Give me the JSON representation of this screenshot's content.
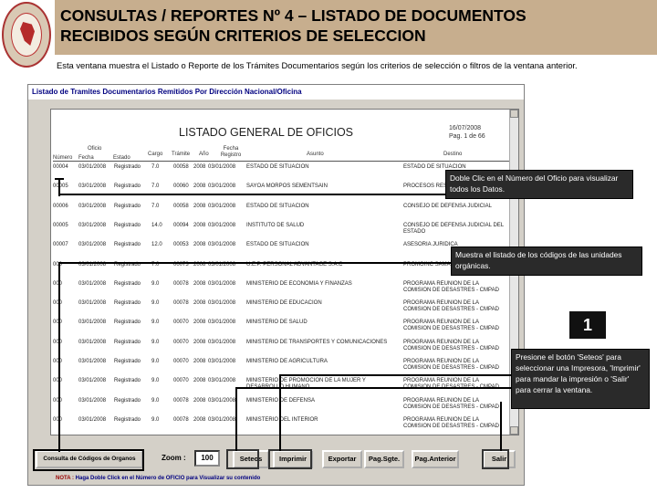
{
  "slide": {
    "title_line1": "CONSULTAS / REPORTES Nº 4 – LISTADO DE DOCUMENTOS",
    "title_line2": "RECIBIDOS SEGÚN CRITERIOS DE SELECCION",
    "intro": "Esta ventana muestra el Listado o Reporte de los Trámites Documentarios según los criterios de selección o filtros de la ventana anterior."
  },
  "window": {
    "title": "Listado de Tramites Documentarios Remitidos Por Dirección Nacional/Oficina",
    "report_title": "LISTADO GENERAL DE OFICIOS",
    "report_date": "16/07/2008",
    "report_page": "Pag. 1 de 66",
    "columns": {
      "numero": "Número",
      "oficio": "Oficio",
      "fecha": "Fecha",
      "estado": "Estado",
      "cargo": "Cargo",
      "tramite": "Trámite",
      "anio": "Año",
      "fecha_registro": "Fecha Registro",
      "asunto": "Asunto",
      "destino": "Destino"
    },
    "rows": [
      {
        "num": "00004",
        "date": "03/01/2008",
        "status": "Registrado",
        "cargo": "7.0",
        "tramite": "00058",
        "year": "2008",
        "freg": "03/01/2008",
        "asunto": "ESTADO DE SITUACION",
        "destino": "ESTADO DE SITUACION"
      },
      {
        "num": "00005",
        "date": "03/01/2008",
        "status": "Registrado",
        "cargo": "7.0",
        "tramite": "00060",
        "year": "2008",
        "freg": "03/01/2008",
        "asunto": "SAYOA MORPOS SEMENTSAIN",
        "destino": "PROCESOS RESOLUTIVOS"
      },
      {
        "num": "00006",
        "date": "03/01/2008",
        "status": "Registrado",
        "cargo": "7.0",
        "tramite": "00058",
        "year": "2008",
        "freg": "03/01/2008",
        "asunto": "ESTADO DE SITUACION",
        "destino": "CONSEJO DE DEFENSA JUDICIAL"
      },
      {
        "num": "00005",
        "date": "03/01/2008",
        "status": "Registrado",
        "cargo": "14.0",
        "tramite": "00094",
        "year": "2008",
        "freg": "03/01/2008",
        "asunto": "INSTITUTO DE SALUD",
        "destino": "CONSEJO DE DEFENSA JUDICIAL DEL ESTADO"
      },
      {
        "num": "00007",
        "date": "03/01/2008",
        "status": "Registrado",
        "cargo": "12.0",
        "tramite": "00053",
        "year": "2008",
        "freg": "03/01/2008",
        "asunto": "ESTADO DE SITUACION",
        "destino": "ASESORIA JURIDICA"
      },
      {
        "num": "000",
        "date": "03/01/2008",
        "status": "Registrado",
        "cargo": "7.0",
        "tramite": "00073",
        "year": "2008",
        "freg": "03/01/2008",
        "asunto": "U.E.P. PERSONAL ADVANTAGE S.A.C",
        "destino": "PROMOINC SAMA DE DEFENSA CIVIL"
      },
      {
        "num": "000",
        "date": "03/01/2008",
        "status": "Registrado",
        "cargo": "9.0",
        "tramite": "00078",
        "year": "2008",
        "freg": "03/01/2008",
        "asunto": "MINISTERIO DE ECONOMIA Y FINANZAS",
        "destino": "PROGRAMA REUNION DE LA COMISION DE DESASTRES - CMPAD"
      },
      {
        "num": "000",
        "date": "03/01/2008",
        "status": "Registrado",
        "cargo": "9.0",
        "tramite": "00078",
        "year": "2008",
        "freg": "03/01/2008",
        "asunto": "MINISTERIO DE EDUCACION",
        "destino": "PROGRAMA REUNION DE LA COMISION DE DESASTRES - CMPAD"
      },
      {
        "num": "000",
        "date": "03/01/2008",
        "status": "Registrado",
        "cargo": "9.0",
        "tramite": "00070",
        "year": "2008",
        "freg": "03/01/2008",
        "asunto": "MINISTERIO DE SALUD",
        "destino": "PROGRAMA REUNION DE LA COMISION DE DESASTRES - CMPAD"
      },
      {
        "num": "000",
        "date": "03/01/2008",
        "status": "Registrado",
        "cargo": "9.0",
        "tramite": "00070",
        "year": "2008",
        "freg": "03/01/2008",
        "asunto": "MINISTERIO DE TRANSPORTES Y COMUNICACIONES",
        "destino": "PROGRAMA REUNION DE LA COMISION DE DESASTRES - CMPAD"
      },
      {
        "num": "000",
        "date": "03/01/2008",
        "status": "Registrado",
        "cargo": "9.0",
        "tramite": "00070",
        "year": "2008",
        "freg": "03/01/2008",
        "asunto": "MINISTERIO DE AGRICULTURA",
        "destino": "PROGRAMA REUNION DE LA COMISION DE DESASTRES - CMPAD"
      },
      {
        "num": "000",
        "date": "03/01/2008",
        "status": "Registrado",
        "cargo": "9.0",
        "tramite": "00070",
        "year": "2008",
        "freg": "03/01/2008",
        "asunto": "MINISTERIO DE PROMOCION DE LA MUJER Y DESARROLLO HUMANO",
        "destino": "PROGRAMA REUNION DE LA COMISION DE DESASTRES - CMPAD"
      },
      {
        "num": "000",
        "date": "03/01/2008",
        "status": "Registrado",
        "cargo": "9.0",
        "tramite": "00078",
        "year": "2008",
        "freg": "03/01/2008",
        "asunto": "MINISTERIO DE DEFENSA",
        "destino": "PROGRAMA REUNION DE LA COMISION DE DESASTRES - CMPAD"
      },
      {
        "num": "000",
        "date": "03/01/2008",
        "status": "Registrado",
        "cargo": "9.0",
        "tramite": "00078",
        "year": "2008",
        "freg": "03/01/2008",
        "asunto": "MINISTERIO DEL INTERIOR",
        "destino": "PROGRAMA REUNION DE LA COMISION DE DESASTRES - CMPAD"
      }
    ],
    "buttons": {
      "consulta": "Consulta de Códigos de Organos",
      "zoom_label": "Zoom :",
      "zoom_value": "100",
      "seteos": "Seteos",
      "imprimir": "Imprimir",
      "exportar": "Exportar",
      "pag_sgte": "Pag.Sgte.",
      "pag_anterior": "Pag.Anterior",
      "salir": "Salir"
    },
    "note_prefix": "NOTA :",
    "note": "Haga Doble Click en el Número de OFICIO para Visualizar su contenido"
  },
  "callouts": {
    "doble_clic": "Doble Clic en el Número del Oficio para visualizar todos los Datos.",
    "codigos": "Muestra el listado de los códigos de las unidades orgánicas.",
    "badge": "1",
    "botones": "Presione el botón 'Seteos' para seleccionar una Impresora, 'Imprimir' para mandar la impresión o 'Salir' para cerrar la ventana."
  }
}
